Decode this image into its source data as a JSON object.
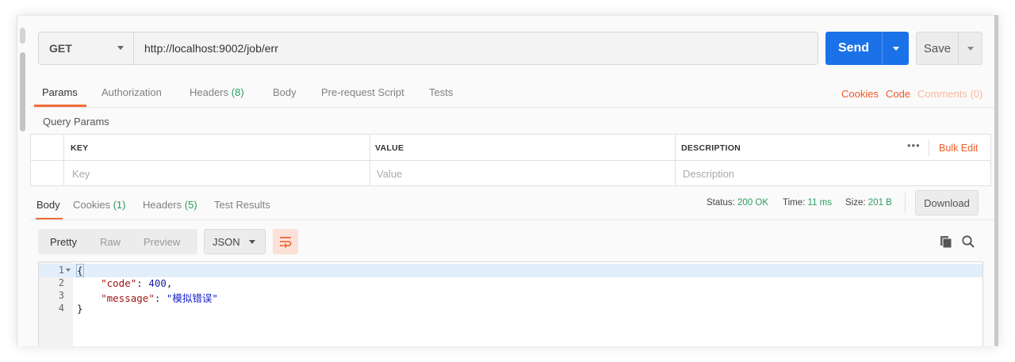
{
  "request": {
    "method": "GET",
    "url": "http://localhost:9002/job/err",
    "send_label": "Send",
    "save_label": "Save"
  },
  "request_tabs": {
    "params": "Params",
    "authorization": "Authorization",
    "headers": "Headers",
    "headers_count": "(8)",
    "body": "Body",
    "prerequest": "Pre-request Script",
    "tests": "Tests"
  },
  "right_links": {
    "cookies": "Cookies",
    "code": "Code",
    "comments": "Comments (0)"
  },
  "query_params": {
    "title": "Query Params",
    "headers": [
      "KEY",
      "VALUE",
      "DESCRIPTION"
    ],
    "placeholders": [
      "Key",
      "Value",
      "Description"
    ],
    "more": "•••",
    "bulk_edit": "Bulk Edit"
  },
  "response_tabs": {
    "body": "Body",
    "cookies": "Cookies",
    "cookies_count": "(1)",
    "headers": "Headers",
    "headers_count": "(5)",
    "test_results": "Test Results"
  },
  "status": {
    "status_label": "Status:",
    "status_value": "200 OK",
    "time_label": "Time:",
    "time_value": "11 ms",
    "size_label": "Size:",
    "size_value": "201 B",
    "download": "Download"
  },
  "viewer": {
    "pretty": "Pretty",
    "raw": "Raw",
    "preview": "Preview",
    "format": "JSON"
  },
  "code": {
    "line_numbers": [
      "1",
      "2",
      "3",
      "4"
    ],
    "open_brace": "{",
    "close_brace": "}",
    "key1": "\"code\"",
    "val1": "400",
    "key2": "\"message\"",
    "val2": "\"模拟错误\""
  },
  "colors": {
    "accent": "#f26b3a",
    "send_blue": "#1b72e8",
    "success_green": "#2a9d5f"
  },
  "icons": [
    "chevron-down-icon",
    "wrap-lines-icon",
    "copy-icon",
    "search-icon"
  ]
}
